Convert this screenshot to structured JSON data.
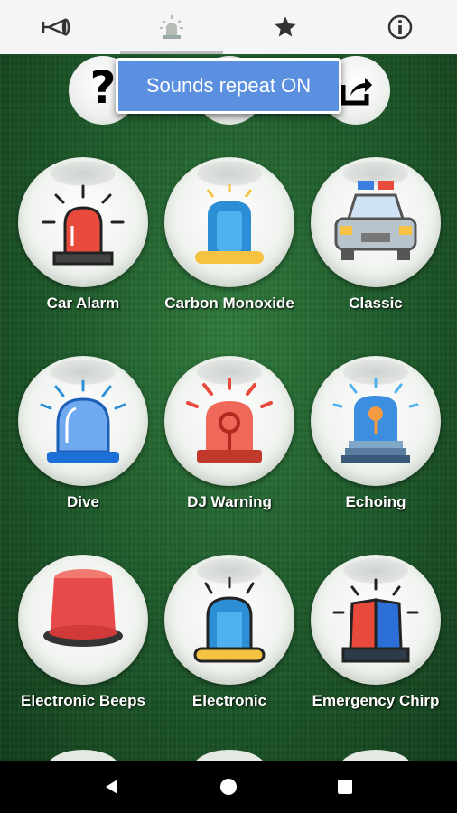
{
  "tabs": [
    {
      "icon": "horn-icon",
      "active": false
    },
    {
      "icon": "siren-icon",
      "active": true
    },
    {
      "icon": "star-icon",
      "active": false
    },
    {
      "icon": "info-icon",
      "active": false
    }
  ],
  "toast": {
    "text": "Sounds repeat ON"
  },
  "top_controls": {
    "help_symbol": "?"
  },
  "sounds": [
    {
      "label": "Car Alarm",
      "icon": "red-siren-light-icon"
    },
    {
      "label": "Carbon Monoxide",
      "icon": "blue-siren-light-icon"
    },
    {
      "label": "Classic",
      "icon": "police-car-icon"
    },
    {
      "label": "Dive",
      "icon": "blue-dome-light-icon"
    },
    {
      "label": "DJ Warning",
      "icon": "red-warning-light-icon"
    },
    {
      "label": "Echoing",
      "icon": "blue-bulb-light-icon"
    },
    {
      "label": "Electronic Beeps",
      "icon": "red-beacon-icon"
    },
    {
      "label": "Electronic",
      "icon": "blue-siren-light-icon"
    },
    {
      "label": "Emergency Chirp",
      "icon": "red-blue-lightbar-icon"
    }
  ],
  "navbar": [
    "back-icon",
    "home-icon",
    "recents-icon"
  ],
  "colors": {
    "accent": "#5b8fe0",
    "background": "#1f5e2c",
    "siren_red": "#e84a3c",
    "siren_blue": "#2c8fd6"
  }
}
